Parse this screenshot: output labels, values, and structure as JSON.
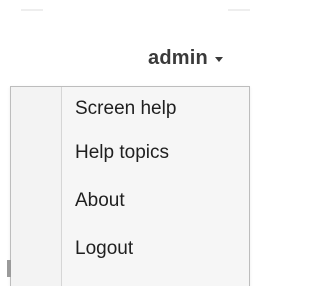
{
  "header": {
    "user_name": "admin",
    "caret_icon": "caret-down-icon"
  },
  "user_menu": {
    "items": [
      {
        "label": "Screen help"
      },
      {
        "label": "Help topics"
      },
      {
        "label": "About"
      },
      {
        "label": "Logout"
      }
    ]
  }
}
